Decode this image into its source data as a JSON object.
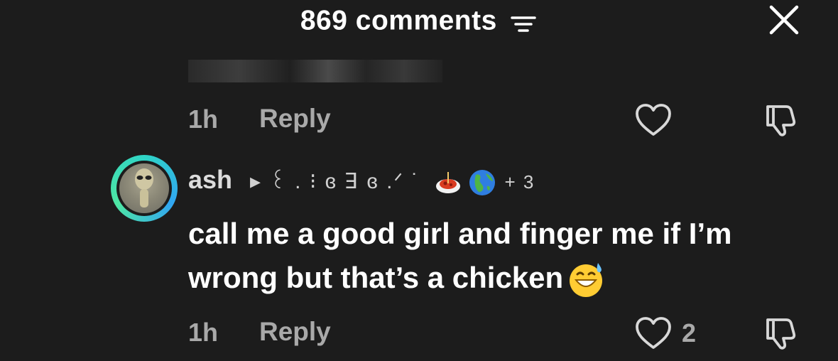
{
  "header": {
    "comment_count_label": "869 comments",
    "filter_icon": "filter-icon",
    "close_icon": "close-icon"
  },
  "previous_comment": {
    "time": "1h",
    "reply_label": "Reply",
    "like_icon": "heart-icon",
    "dislike_icon": "dislike-icon"
  },
  "comment": {
    "username": "ash",
    "name_decoration": "▸ ꒰ . ⁝ ɞ ꓱ ɞ .ᐟ ˙",
    "name_suffix": "+ 3",
    "text": "call me a good girl and finger me if I’m wrong but that’s a chicken",
    "time": "1h",
    "reply_label": "Reply",
    "like_count": "2",
    "like_icon": "heart-icon",
    "dislike_icon": "dislike-icon"
  },
  "colors": {
    "background": "#1c1c1c",
    "text_primary": "#ffffff",
    "text_secondary": "#a9a9a9",
    "avatar_ring": "#2fd5c6"
  }
}
